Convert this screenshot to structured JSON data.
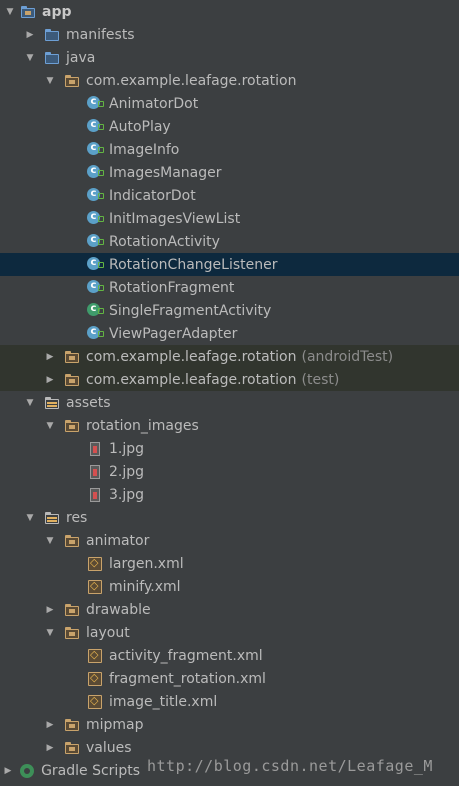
{
  "tree": [
    {
      "label": "app",
      "arrow": "▼",
      "icon": "folder-module-icon",
      "bold": true
    },
    {
      "label": "manifests",
      "arrow": "▶",
      "icon": "folder-icon"
    },
    {
      "label": "java",
      "arrow": "▼",
      "icon": "folder-icon"
    },
    {
      "label": "com.example.leafage.rotation",
      "arrow": "▼",
      "icon": "package-icon"
    },
    {
      "label": "AnimatorDot",
      "icon": "class-icon"
    },
    {
      "label": "AutoPlay",
      "icon": "class-icon"
    },
    {
      "label": "ImageInfo",
      "icon": "class-icon"
    },
    {
      "label": "ImagesManager",
      "icon": "class-icon"
    },
    {
      "label": "IndicatorDot",
      "icon": "class-icon"
    },
    {
      "label": "InitImagesViewList",
      "icon": "class-icon"
    },
    {
      "label": "RotationActivity",
      "icon": "class-icon"
    },
    {
      "label": "RotationChangeListener",
      "icon": "class-icon",
      "selected": true
    },
    {
      "label": "RotationFragment",
      "icon": "class-icon"
    },
    {
      "label": "SingleFragmentActivity",
      "icon": "activity-class-icon"
    },
    {
      "label": "ViewPagerAdapter",
      "icon": "class-icon"
    },
    {
      "label": "com.example.leafage.rotation",
      "suffix": "(androidTest)",
      "arrow": "▶",
      "icon": "package-icon",
      "test": true
    },
    {
      "label": "com.example.leafage.rotation",
      "suffix": "(test)",
      "arrow": "▶",
      "icon": "package-icon",
      "test": true
    },
    {
      "label": "assets",
      "arrow": "▼",
      "icon": "resource-folder-icon"
    },
    {
      "label": "rotation_images",
      "arrow": "▼",
      "icon": "folder-icon"
    },
    {
      "label": "1.jpg",
      "icon": "image-file-icon"
    },
    {
      "label": "2.jpg",
      "icon": "image-file-icon"
    },
    {
      "label": "3.jpg",
      "icon": "image-file-icon"
    },
    {
      "label": "res",
      "arrow": "▼",
      "icon": "resource-folder-icon"
    },
    {
      "label": "animator",
      "arrow": "▼",
      "icon": "folder-icon"
    },
    {
      "label": "largen.xml",
      "icon": "xml-file-icon"
    },
    {
      "label": "minify.xml",
      "icon": "xml-file-icon"
    },
    {
      "label": "drawable",
      "arrow": "▶",
      "icon": "folder-icon"
    },
    {
      "label": "layout",
      "arrow": "▼",
      "icon": "folder-icon"
    },
    {
      "label": "activity_fragment.xml",
      "icon": "xml-file-icon"
    },
    {
      "label": "fragment_rotation.xml",
      "icon": "xml-file-icon"
    },
    {
      "label": "image_title.xml",
      "icon": "xml-file-icon"
    },
    {
      "label": "mipmap",
      "arrow": "▶",
      "icon": "folder-icon"
    },
    {
      "label": "values",
      "arrow": "▶",
      "icon": "folder-icon"
    },
    {
      "label": "Gradle Scripts",
      "arrow": "▶",
      "icon": "gradle-icon"
    }
  ],
  "watermark": "http://blog.csdn.net/Leafage_M",
  "colors": {
    "background": "#3c3f41",
    "selected": "#0d293e",
    "test_band": "#31352e",
    "text": "#bbbbbb"
  }
}
